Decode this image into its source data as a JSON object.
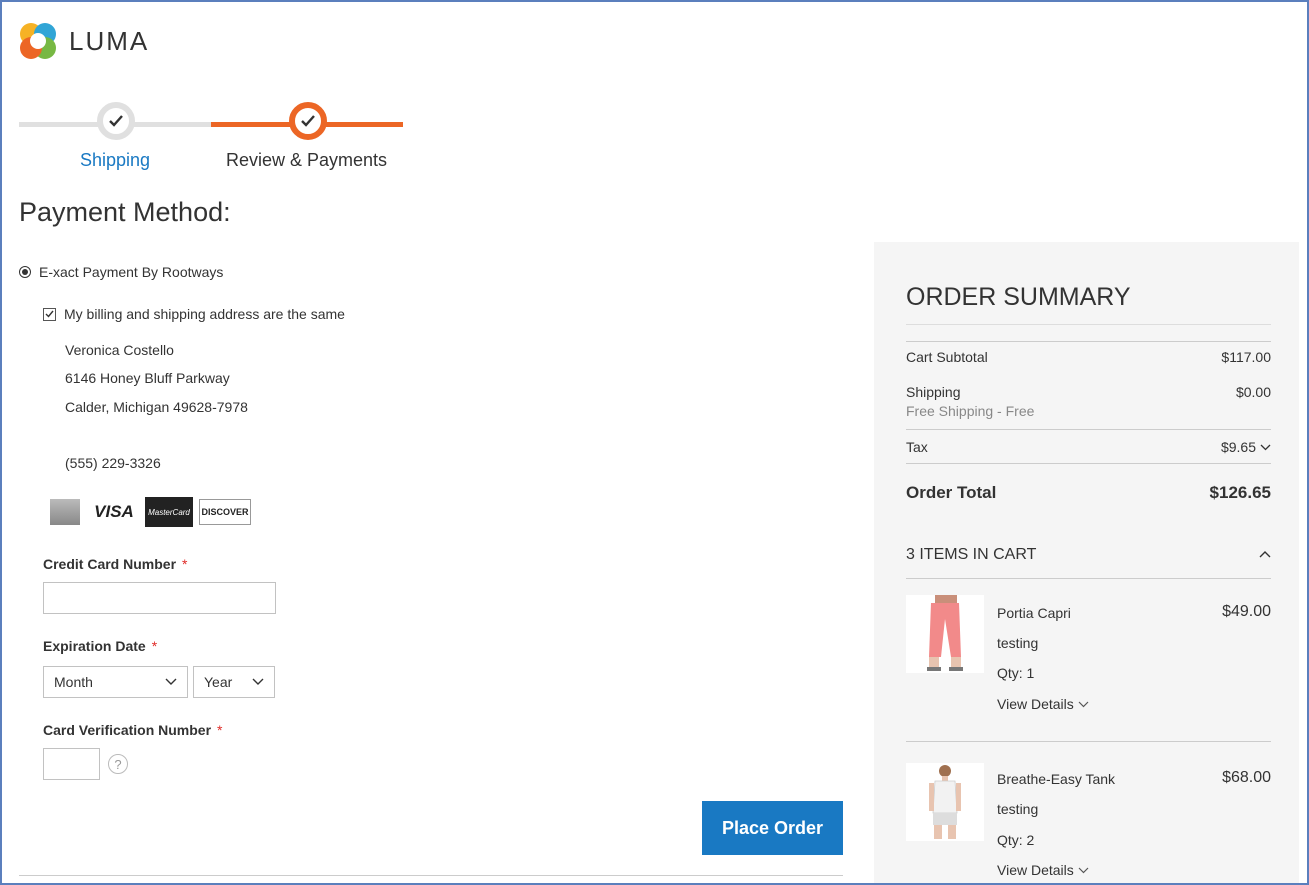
{
  "brand": {
    "name": "LUMA"
  },
  "progress": {
    "steps": [
      {
        "label": "Shipping"
      },
      {
        "label": "Review & Payments"
      }
    ]
  },
  "page_title": "Payment Method:",
  "payment": {
    "method_label": "E-xact Payment By Rootways",
    "same_address_label": "My billing and shipping address are the same",
    "address": {
      "name": "Veronica Costello",
      "street": "6146 Honey Bluff Parkway",
      "city_line": "Calder, Michigan 49628-7978",
      "phone": "(555) 229-3326"
    },
    "card_icons": [
      "amex-icon",
      "visa-icon",
      "mastercard-icon",
      "discover-icon"
    ],
    "card_labels": {
      "visa": "VISA",
      "mastercard": "MasterCard",
      "discover": "DISCOVER"
    },
    "credit_card_label": "Credit Card Number",
    "expiration_label": "Expiration Date",
    "month_value": "Month",
    "year_value": "Year",
    "cvv_label": "Card Verification Number",
    "required_mark": "*",
    "help_glyph": "?",
    "place_order_label": "Place Order"
  },
  "summary": {
    "title": "ORDER SUMMARY",
    "cart_subtotal_label": "Cart Subtotal",
    "cart_subtotal_value": "$117.00",
    "shipping_label": "Shipping",
    "shipping_method": "Free Shipping - Free",
    "shipping_value": "$0.00",
    "tax_label": "Tax",
    "tax_value": "$9.65",
    "order_total_label": "Order Total",
    "order_total_value": "$126.65",
    "items_in_cart_label": "3 Items in Cart",
    "items": [
      {
        "name": "Portia Capri",
        "option": "testing",
        "qty": "Qty: 1",
        "details": "View Details",
        "price": "$49.00"
      },
      {
        "name": "Breathe-Easy Tank",
        "option": "testing",
        "qty": "Qty: 2",
        "details": "View Details",
        "price": "$68.00"
      }
    ]
  },
  "colors": {
    "accent": "#ec6625",
    "link": "#1979c3",
    "button": "#1979c3"
  }
}
